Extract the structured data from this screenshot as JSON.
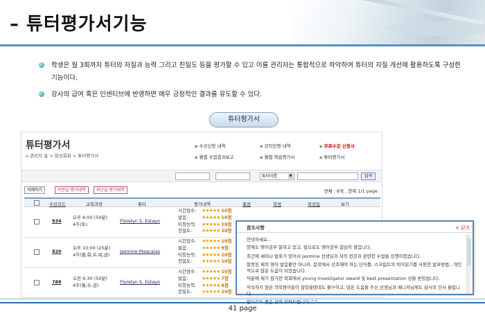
{
  "slide": {
    "title": "– 튜터평가서기능",
    "bullets": [
      "학생은 월 3회까지 튜터의 자질과 능력 그리고 친밀도 등을 평가할 수 있고 이를 관리자는 통합적으로 파악하여 튜터의 자질 개선에 활용하도록 구성한 기능이다.",
      "강사의 급여 혹은 인센티브에 반영하면 매우 긍정적인 결과를 유도할 수 있다."
    ],
    "pill_label": "튜터평가서",
    "page_number": "41 page"
  },
  "panel": {
    "title": "튜터평가서",
    "breadcrumb": "관리자 홈 > 화상회화 > 튜터평가서",
    "menu": [
      {
        "label": "수강신청 내역",
        "red": false
      },
      {
        "label": "강의진행 내역",
        "red": false
      },
      {
        "label": "무료수강 신청서",
        "red": true
      },
      {
        "label": "월별 수업결과보고",
        "red": false
      },
      {
        "label": "월별 학습평가서",
        "red": false
      },
      {
        "label": "튜터평가서",
        "red": false
      }
    ],
    "filter": {
      "select_value": "튜터이름",
      "search_button": "검색"
    },
    "actions": {
      "delete": "삭제하기",
      "prev_month": "이번달 평가내역",
      "last_month": "지난달 평가내역",
      "total": "전체 : 8개 , 현재 1/1 page"
    },
    "columns": [
      "수강코드",
      "교육과정",
      "튜터",
      "평가내역",
      "총점",
      "학생",
      "작성일",
      "보기"
    ],
    "rating_labels": [
      "시간엄수:",
      "발음:",
      "티칭능력:",
      "친밀도:"
    ],
    "rows": [
      {
        "code": "934",
        "course_line1": "오후 8:00 (50분)",
        "course_line2": "4주(토)",
        "tutor": "Florelyn S. Estayo",
        "stars": [
          "★★★★★",
          "★★★★★",
          "★★★★★",
          "★★★★★"
        ],
        "scores": [
          "10점",
          "10점",
          "10점",
          "10점"
        ]
      },
      {
        "code": "820",
        "course_line1": "오후 10:00 (25분)",
        "course_line2": "4주(월,화,수,목,금)",
        "tutor": "Jasmine Magcalas",
        "stars": [
          "★★★★★",
          "★★★★★",
          "★★★★★",
          "★★★★★"
        ],
        "scores": [
          "10점",
          "9점",
          "10점",
          "10점"
        ]
      },
      {
        "code": "788",
        "course_line1": "오전 9:30 (50분)",
        "course_line2": "4주(월,수,금)",
        "tutor": "Florelyn S. Estayo",
        "stars": [
          "★★★★★",
          "★★★★★",
          "★★★★★",
          "★★★★★"
        ],
        "scores": [
          "10점",
          "7점",
          "6점",
          "10점"
        ]
      }
    ]
  },
  "popup": {
    "title": "참조사항",
    "close": "× 닫기",
    "lines": [
      "안녕하세요...",
      "현재도 영어공부 잘하고 있고, 앞으로도 영어공부 열심히 할겁니다.",
      "최근에 세미나 발표가 있어서 Jasmine 선생님과 저의 전공과 관련한 수업을 진행하였습니다.",
      "잘못된 제의 영어 발음뿐만 아니라, 문장에서 강조해야 하는 단어를, 스크립트의 띄어읽기를 사용한 발표방법...개인적으로 많은 도움이 되었습니다.",
      "덕분에 제가 참가한 학회에서 young investigator award 및 best presentation 상을 받았습니다.",
      "익숙하지 않은 의학용어들이 많았을텐데도 불구하고, 많은 도움을 주신 선생님과 매니저님께도 감사의 인사 올립니다.",
      "앞으로도 좋은 강의 부탁드립니다.^^"
    ]
  }
}
